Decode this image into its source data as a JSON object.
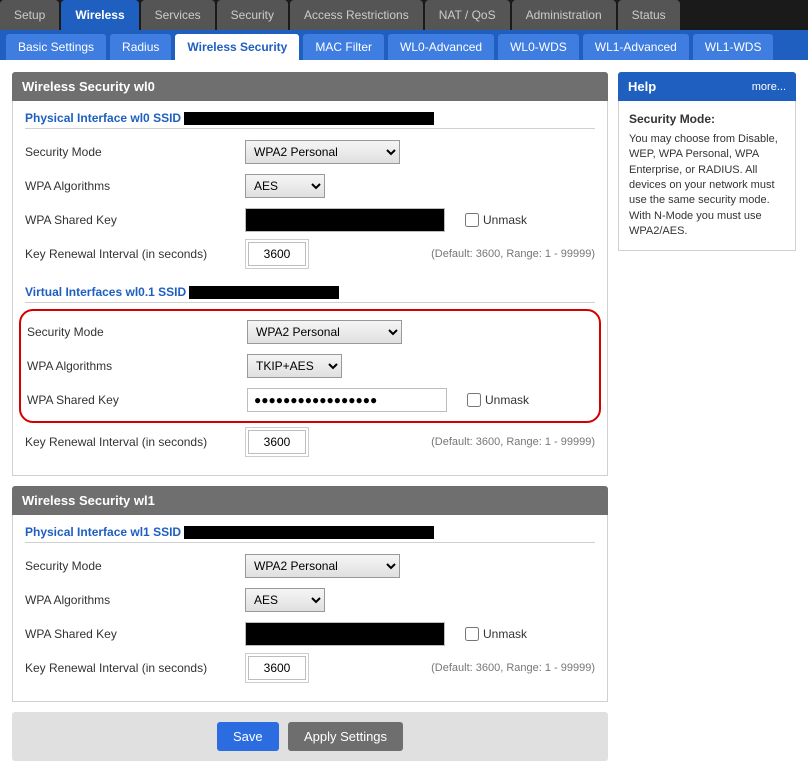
{
  "topTabs": [
    "Setup",
    "Wireless",
    "Services",
    "Security",
    "Access Restrictions",
    "NAT / QoS",
    "Administration",
    "Status"
  ],
  "topActive": 1,
  "subTabs": [
    "Basic Settings",
    "Radius",
    "Wireless Security",
    "MAC Filter",
    "WL0-Advanced",
    "WL0-WDS",
    "WL1-Advanced",
    "WL1-WDS"
  ],
  "subActive": 2,
  "wl0": {
    "header": "Wireless Security wl0",
    "phys": {
      "title": "Physical Interface wl0 SSID",
      "labels": {
        "mode": "Security Mode",
        "algo": "WPA Algorithms",
        "key": "WPA Shared Key",
        "interval": "Key Renewal Interval (in seconds)"
      },
      "mode": "WPA2 Personal",
      "algo": "AES",
      "interval": "3600",
      "hint": "(Default: 3600, Range: 1 - 99999)",
      "unmask": "Unmask"
    },
    "virt": {
      "title": "Virtual Interfaces wl0.1 SSID",
      "labels": {
        "mode": "Security Mode",
        "algo": "WPA Algorithms",
        "key": "WPA Shared Key",
        "interval": "Key Renewal Interval (in seconds)"
      },
      "mode": "WPA2 Personal",
      "algo": "TKIP+AES",
      "key": "●●●●●●●●●●●●●●●●●",
      "interval": "3600",
      "hint": "(Default: 3600, Range: 1 - 99999)",
      "unmask": "Unmask"
    }
  },
  "wl1": {
    "header": "Wireless Security wl1",
    "phys": {
      "title": "Physical Interface wl1 SSID",
      "labels": {
        "mode": "Security Mode",
        "algo": "WPA Algorithms",
        "key": "WPA Shared Key",
        "interval": "Key Renewal Interval (in seconds)"
      },
      "mode": "WPA2 Personal",
      "algo": "AES",
      "interval": "3600",
      "hint": "(Default: 3600, Range: 1 - 99999)",
      "unmask": "Unmask"
    }
  },
  "buttons": {
    "save": "Save",
    "apply": "Apply Settings"
  },
  "help": {
    "title": "Help",
    "more": "more...",
    "heading": "Security Mode:",
    "body": "You may choose from Disable, WEP, WPA Personal, WPA Enterprise, or RADIUS. All devices on your network must use the same security mode. With N-Mode you must use WPA2/AES."
  }
}
